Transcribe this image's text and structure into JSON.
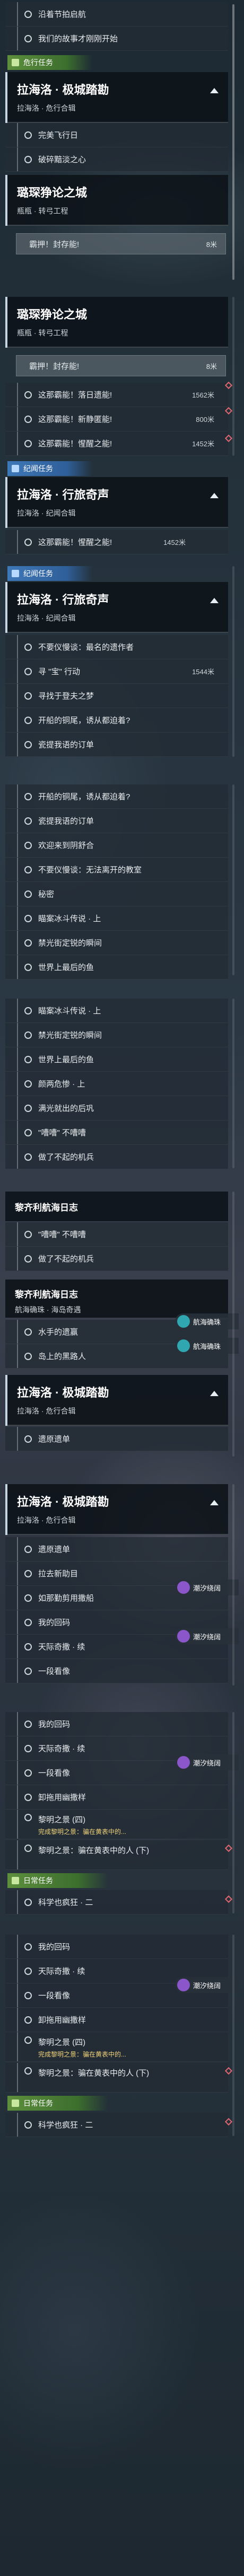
{
  "seg1": {
    "rows": [
      "沿着节拍启航",
      "我们的故事才刚刚开始"
    ],
    "section": "危行任务",
    "header": {
      "title": "拉海洛 · 极城踏勘",
      "sub": "拉海洛 · 危行合辑"
    },
    "rows2": [
      "完美飞行日",
      "破碎黯淡之心"
    ],
    "header2": {
      "title": "璐琛狰论之城",
      "sub": "瓶瓶 · 转弓工程"
    },
    "done": {
      "label": "霸押！封存能!",
      "meta": "8米"
    }
  },
  "seg2": {
    "header": {
      "title": "璐琛狰论之城",
      "sub": "瓶瓶 · 转弓工程"
    },
    "done": {
      "label": "霸押！封存能!",
      "meta": "8米"
    },
    "rows": [
      {
        "label": "这那霸能！落日遗能!",
        "meta": "1562米"
      },
      {
        "label": "这那霸能！新静匿能!",
        "meta": "800米"
      },
      {
        "label": "这那霸能！惺醒之能!",
        "meta": "1452米"
      }
    ]
  },
  "seg3": {
    "section": "纪闻任务",
    "header": {
      "title": "拉海洛 · 行旅奇声",
      "sub": "拉海洛 · 纪闻合辑"
    },
    "rows": [
      {
        "label": "这那霸能！惺醒之能!",
        "meta": "1452米"
      }
    ]
  },
  "seg4": {
    "section": "纪闻任务",
    "header": {
      "title": "拉海洛 · 行旅奇声",
      "sub": "拉海洛 · 纪闻合辑"
    },
    "rows": [
      {
        "label": "不要仪慢谈：最名的遗作者",
        "meta": ""
      },
      {
        "label": "寻 \"宝\" 行动",
        "meta": "1544米"
      },
      {
        "label": "寻找于登夫之梦",
        "meta": ""
      },
      {
        "label": "开船的铜尾，诱从都迫着?",
        "meta": ""
      },
      {
        "label": "瓷提我语的订单",
        "meta": ""
      }
    ]
  },
  "seg5": {
    "rows": [
      "开船的铜尾，诱从都迫着?",
      "瓷提我语的订单",
      "欢迎来到阴舒合",
      "不要仪慢谈：无法离开的教室",
      "秘密",
      "瞄案冰斗传说 · 上",
      "禁光街定锐的瞬间",
      "世界上最后的鱼"
    ]
  },
  "seg6": {
    "rows": [
      "瞄案冰斗传说 · 上",
      "禁光街定锐的瞬间",
      "世界上最后的鱼",
      "颜两危惨 · 上",
      "满光就出的后巩",
      "\"嘈嘈\" 不嘈嘈",
      "做了不起的机兵"
    ]
  },
  "seg7": {
    "header": {
      "title": "黎齐利航海日志"
    },
    "rows": [
      "\"嘈嘈\" 不嘈嘈",
      "做了不起的机兵"
    ]
  },
  "seg8": {
    "header": {
      "title": "黎齐利航海日志",
      "sub": "航海确珠 · 海岛奇遇"
    },
    "rows": [
      "水手的遗赢",
      "岛上的黑路人"
    ],
    "tag": "航海确珠",
    "header2": {
      "title": "拉海洛 · 极城踏勘",
      "sub": "拉海洛 · 危行合辑"
    },
    "rows2": [
      "遗原遗单"
    ]
  },
  "seg9": {
    "header": {
      "title": "拉海洛 · 极城踏勘",
      "sub": "拉海洛 · 危行合辑"
    },
    "rows": [
      "遗原遗单",
      "拉去新助目",
      "如那勤剪用撒船",
      "我的回码",
      "天际奇撒 · 续",
      "一段看像"
    ],
    "tag": "潮汐绕阔"
  },
  "seg10": {
    "rows": [
      "我的回码",
      "天际奇撒 · 续",
      "一段看像",
      "卸拖用幽撒样"
    ],
    "tag": "潮汐绕阔",
    "quests": [
      {
        "title": "黎明之景 (四)",
        "note": "完成黎明之景：骗在黄表中的..."
      },
      {
        "title": "黎明之景：骗在黄表中的人 (下)",
        "note": ""
      }
    ],
    "section": "日常任务",
    "rows2": [
      "科学也疯狂 · 二"
    ]
  },
  "seg11": {
    "rows": [
      "我的回码",
      "天际奇撒 · 续",
      "一段看像",
      "卸拖用幽撒样"
    ],
    "tag": "潮汐绕阔",
    "quests": [
      {
        "title": "黎明之景 (四)",
        "note": "完成黎明之景：骗在黄表中的..."
      },
      {
        "title": "黎明之景：骗在黄表中的人 (下)",
        "note": ""
      }
    ],
    "section": "日常任务",
    "rows2": [
      "科学也疯狂 · 二"
    ]
  }
}
